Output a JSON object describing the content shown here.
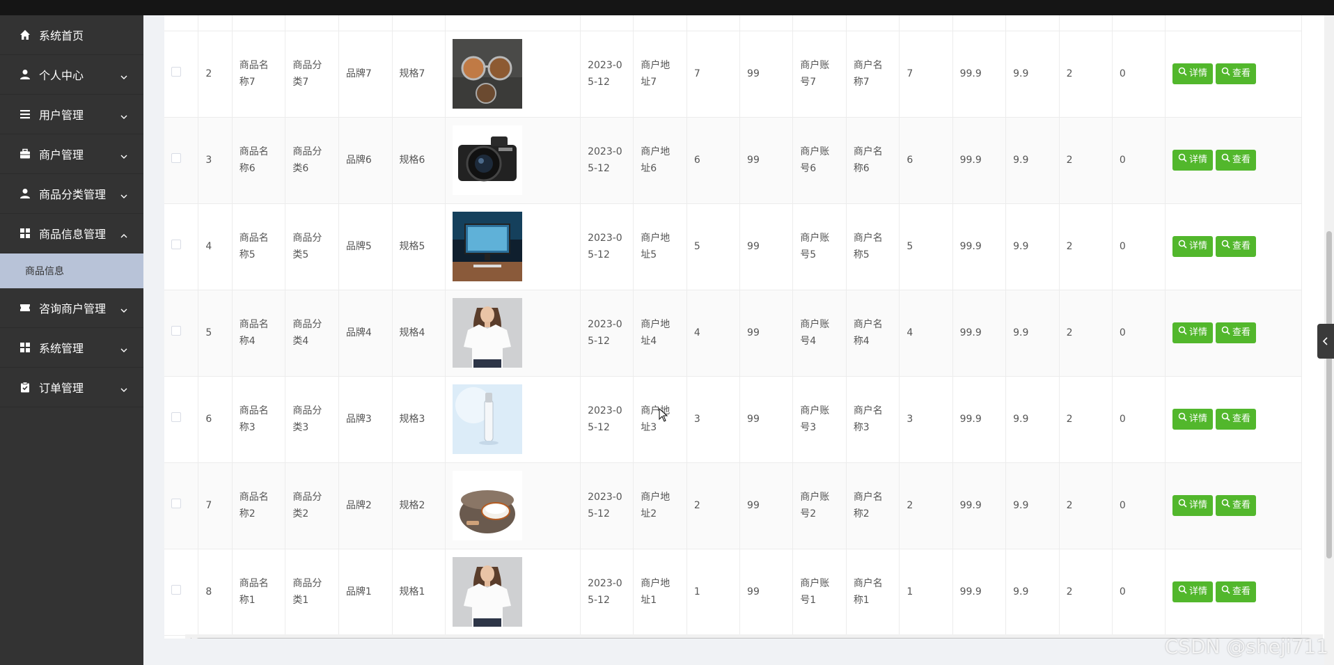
{
  "sidebar": {
    "items": [
      {
        "label": "系统首页",
        "icon": "home-icon",
        "has_arrow": false
      },
      {
        "label": "个人中心",
        "icon": "user-icon",
        "has_arrow": true
      },
      {
        "label": "用户管理",
        "icon": "list-icon",
        "has_arrow": true
      },
      {
        "label": "商户管理",
        "icon": "briefcase-icon",
        "has_arrow": true
      },
      {
        "label": "商品分类管理",
        "icon": "user-icon",
        "has_arrow": true
      },
      {
        "label": "商品信息管理",
        "icon": "grid-icon",
        "has_arrow": true,
        "expanded": true
      },
      {
        "label": "咨询商户管理",
        "icon": "ticket-icon",
        "has_arrow": true
      },
      {
        "label": "系统管理",
        "icon": "grid-icon",
        "has_arrow": true
      },
      {
        "label": "订单管理",
        "icon": "clipboard-icon",
        "has_arrow": true
      }
    ],
    "submenu": {
      "label": "商品信息"
    }
  },
  "table": {
    "rows": [
      {
        "index": "2",
        "name": "商品名称7",
        "category": "商品分类7",
        "brand": "品牌7",
        "spec": "规格7",
        "image": "sunglasses",
        "date": "2023-05-12",
        "address": "商户地址7",
        "c1": "7",
        "c2": "99",
        "account": "商户账号7",
        "merchant": "商户名称7",
        "c3": "7",
        "price": "99.9",
        "c4": "9.9",
        "c5": "2",
        "c6": "0"
      },
      {
        "index": "3",
        "name": "商品名称6",
        "category": "商品分类6",
        "brand": "品牌6",
        "spec": "规格6",
        "image": "camera",
        "date": "2023-05-12",
        "address": "商户地址6",
        "c1": "6",
        "c2": "99",
        "account": "商户账号6",
        "merchant": "商户名称6",
        "c3": "6",
        "price": "99.9",
        "c4": "9.9",
        "c5": "2",
        "c6": "0"
      },
      {
        "index": "4",
        "name": "商品名称5",
        "category": "商品分类5",
        "brand": "品牌5",
        "spec": "规格5",
        "image": "monitor",
        "date": "2023-05-12",
        "address": "商户地址5",
        "c1": "5",
        "c2": "99",
        "account": "商户账号5",
        "merchant": "商户名称5",
        "c3": "5",
        "price": "99.9",
        "c4": "9.9",
        "c5": "2",
        "c6": "0"
      },
      {
        "index": "5",
        "name": "商品名称4",
        "category": "商品分类4",
        "brand": "品牌4",
        "spec": "规格4",
        "image": "tshirt",
        "date": "2023-05-12",
        "address": "商户地址4",
        "c1": "4",
        "c2": "99",
        "account": "商户账号4",
        "merchant": "商户名称4",
        "c3": "4",
        "price": "99.9",
        "c4": "9.9",
        "c5": "2",
        "c6": "0"
      },
      {
        "index": "6",
        "name": "商品名称3",
        "category": "商品分类3",
        "brand": "品牌3",
        "spec": "规格3",
        "image": "serum",
        "date": "2023-05-12",
        "address": "商户地址3",
        "c1": "3",
        "c2": "99",
        "account": "商户账号3",
        "merchant": "商户名称3",
        "c3": "3",
        "price": "99.9",
        "c4": "9.9",
        "c5": "2",
        "c6": "0"
      },
      {
        "index": "7",
        "name": "商品名称2",
        "category": "商品分类2",
        "brand": "品牌2",
        "spec": "规格2",
        "image": "ricecooker",
        "date": "2023-05-12",
        "address": "商户地址2",
        "c1": "2",
        "c2": "99",
        "account": "商户账号2",
        "merchant": "商户名称2",
        "c3": "2",
        "price": "99.9",
        "c4": "9.9",
        "c5": "2",
        "c6": "0"
      },
      {
        "index": "8",
        "name": "商品名称1",
        "category": "商品分类1",
        "brand": "品牌1",
        "spec": "规格1",
        "image": "tshirt",
        "date": "2023-05-12",
        "address": "商户地址1",
        "c1": "1",
        "c2": "99",
        "account": "商户账号1",
        "merchant": "商户名称1",
        "c3": "1",
        "price": "99.9",
        "c4": "9.9",
        "c5": "2",
        "c6": "0"
      }
    ],
    "actions": {
      "detail_label": "详情",
      "view_label": "查看"
    }
  },
  "watermark": "CSDN @sheji711",
  "colors": {
    "sidebar_bg": "#333333",
    "submenu_active_bg": "#b8c3d8",
    "button_green": "#52b72c"
  }
}
